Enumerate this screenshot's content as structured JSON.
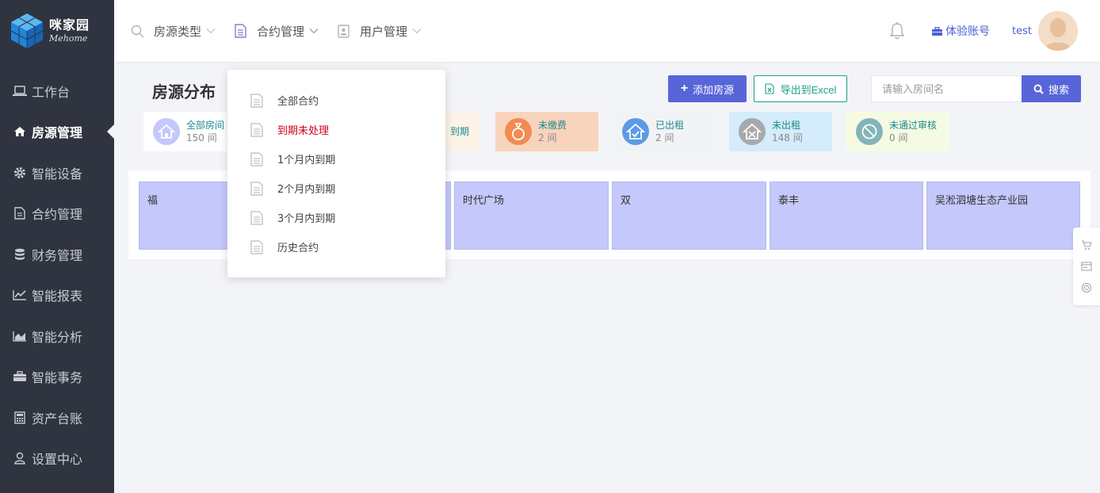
{
  "app": {
    "logo_cn": "咪家园",
    "logo_en": "Mehome",
    "brand_color": "#2f3440",
    "accent_color": "#5865d8"
  },
  "sidebar": {
    "items": [
      {
        "label": "工作台",
        "icon": "laptop-icon"
      },
      {
        "label": "房源管理",
        "icon": "home-icon",
        "active": true
      },
      {
        "label": "智能设备",
        "icon": "gear-icon"
      },
      {
        "label": "合约管理",
        "icon": "document-icon"
      },
      {
        "label": "财务管理",
        "icon": "database-icon"
      },
      {
        "label": "智能报表",
        "icon": "line-chart-icon"
      },
      {
        "label": "智能分析",
        "icon": "area-chart-icon"
      },
      {
        "label": "智能事务",
        "icon": "briefcase-icon"
      },
      {
        "label": "资产台账",
        "icon": "calculator-icon"
      },
      {
        "label": "设置中心",
        "icon": "user-icon"
      }
    ]
  },
  "topbar": {
    "menu": [
      {
        "label": "房源类型",
        "icon": "search-icon"
      },
      {
        "label": "合约管理",
        "icon": "document-icon",
        "open": true
      },
      {
        "label": "用户管理",
        "icon": "contact-icon"
      }
    ],
    "trial_label": "体验账号",
    "username": "test"
  },
  "contract_menu": {
    "items": [
      {
        "label": "全部合约"
      },
      {
        "label": "到期未处理",
        "alert": true
      },
      {
        "label": "1个月内到期"
      },
      {
        "label": "2个月内到期"
      },
      {
        "label": "3个月内到期"
      },
      {
        "label": "历史合约"
      }
    ]
  },
  "main": {
    "title": "房源分布",
    "add_button": "添加房源",
    "export_button": "导出到Excel",
    "search_placeholder": "请输入房间名",
    "search_button": "搜索",
    "stats": [
      {
        "label": "全部房间",
        "count": "150 间",
        "bg": "#ffffff",
        "icon_bg": "#c4c8fb"
      },
      {
        "label": "到期",
        "count": "",
        "bg": "#fdf3e8",
        "icon_bg": "#f6c79a"
      },
      {
        "label": "未缴费",
        "count": "2 间",
        "bg": "#f8d4bd",
        "icon_bg": "#f28b52"
      },
      {
        "label": "已出租",
        "count": "2 间",
        "bg": "#f2f3f5",
        "icon_bg": "#5b9be6"
      },
      {
        "label": "未出租",
        "count": "148 间",
        "bg": "#d4ecfb",
        "icon_bg": "#a6a9ad"
      },
      {
        "label": "未通过审核",
        "count": "0 间",
        "bg": "#f5fbe2",
        "icon_bg": "#84b4b8"
      }
    ],
    "tiles": [
      {
        "label": "福"
      },
      {
        "label": ""
      },
      {
        "label": "时代广场"
      },
      {
        "label": "双"
      },
      {
        "label": "泰丰"
      },
      {
        "label": "吴淞泗塘生态产业园"
      }
    ]
  }
}
